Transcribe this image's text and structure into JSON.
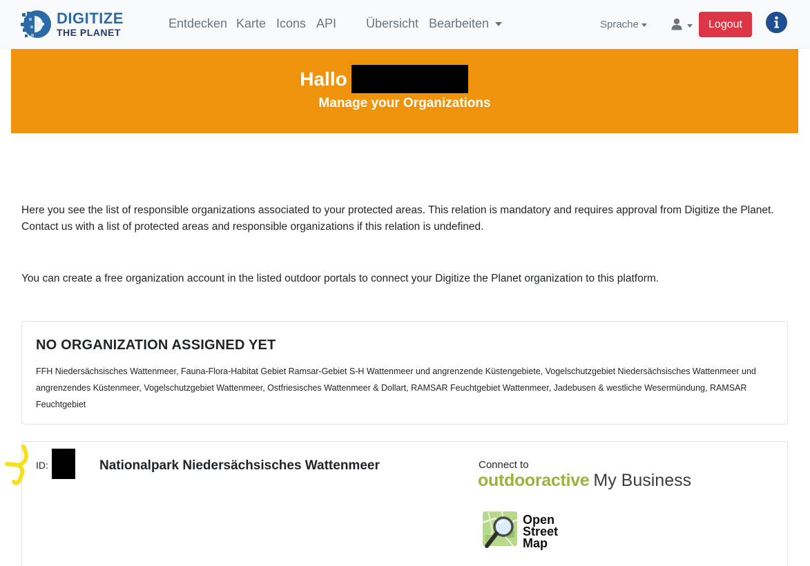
{
  "brand": {
    "line1": "DIGITIZE",
    "line2": "THE PLANET"
  },
  "nav": {
    "entdecken": "Entdecken",
    "karte": "Karte",
    "icons": "Icons",
    "api": "API",
    "uebersicht": "Übersicht",
    "bearbeiten": "Bearbeiten",
    "sprache": "Sprache",
    "logout": "Logout"
  },
  "banner": {
    "greeting": "Hallo",
    "subtitle": "Manage your Organizations"
  },
  "intro": {
    "paragraph1": "Here you see the list of responsible organizations associated to your protected areas. This relation is mandatory and requires approval from Digitize the Planet. Contact us with a list of protected areas and responsible organizations if this relation is undefined.",
    "paragraph2": "You can create a free organization account in the listed outdoor portals to connect your Digitize the Planet organization to this platform."
  },
  "unassigned": {
    "title": "NO ORGANIZATION ASSIGNED YET",
    "areas": "FFH Niedersächsisches Wattenmeer, Fauna-Flora-Habitat Gebiet Ramsar-Gebiet S-H Wattenmeer und angrenzende Küstengebiete, Vogelschutzgebiet Niedersächsisches Wattenmeer und angrenzendes Küstenmeer, Vogelschutzgebiet Wattenmeer, Ostfriesisches Wattenmeer & Dollart, RAMSAR Feuchtgebiet Wattenmeer, Jadebusen & westliche Wesermündung, RAMSAR Feuchtgebiet"
  },
  "organization": {
    "id_label": "ID:",
    "name": "Nationalpark Niedersächsisches Wattenmeer",
    "connect_label": "Connect to",
    "outdooractive_brand": "outdooractive",
    "outdooractive_product": "My Business",
    "osm_line1": "Open",
    "osm_line2": "Street",
    "osm_line3": "Map"
  },
  "colors": {
    "banner": "#f0930c",
    "logout": "#dc3545",
    "brand_blue": "#2a6ba7",
    "outdooractive_green": "#9bb33a",
    "highlight": "#f7e01a"
  },
  "icons": {
    "user": "user-icon",
    "info": "info-icon",
    "brand": "pixel-globe-logo-icon",
    "osm": "osm-magnifier-map-icon"
  }
}
